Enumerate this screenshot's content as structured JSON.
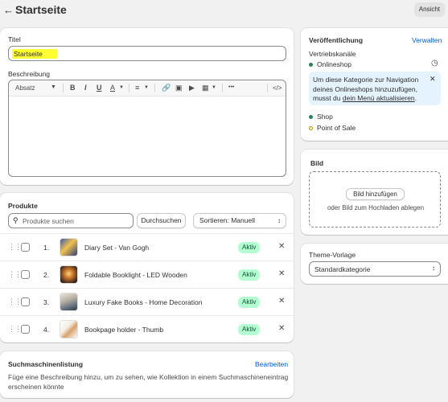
{
  "header": {
    "title": "Startseite",
    "view_label": "Ansicht"
  },
  "title_card": {
    "title_label": "Titel",
    "title_value": "Startseite",
    "description_label": "Beschreibung",
    "toolbar": {
      "format": "Absatz",
      "bold": "B",
      "italic": "I",
      "underline": "U",
      "text_color": "A",
      "more": "•••",
      "code": "</>"
    }
  },
  "products": {
    "heading": "Produkte",
    "search_placeholder": "Produkte suchen",
    "browse_label": "Durchsuchen",
    "sort_label": "Sortieren: Manuell",
    "items": [
      {
        "index": "1.",
        "name": "Diary Set - Van Gogh",
        "status": "Aktiv"
      },
      {
        "index": "2.",
        "name": "Foldable Booklight - LED Wooden",
        "status": "Aktiv"
      },
      {
        "index": "3.",
        "name": "Luxury Fake Books - Home Decoration",
        "status": "Aktiv"
      },
      {
        "index": "4.",
        "name": "Bookpage holder - Thumb",
        "status": "Aktiv"
      }
    ]
  },
  "seo": {
    "heading": "Suchmaschinenlistung",
    "edit_label": "Bearbeiten",
    "text": "Füge eine Beschreibung hinzu, um zu sehen, wie Kollektion in einem Suchmaschineneintrag erscheinen könnte"
  },
  "publishing": {
    "heading": "Veröffentlichung",
    "manage_label": "Verwalten",
    "channels_label": "Vertriebskanäle",
    "channel_online": "Onlineshop",
    "banner_text_1": "Um diese Kategorie zur Navigation deines Onlineshops hinzuzufügen, musst du",
    "banner_link": "dein Menü aktualisieren",
    "banner_text_2": ".",
    "channel_shop": "Shop",
    "channel_pos": "Point of Sale",
    "status_colors": {
      "active": "#29845a",
      "inactive": "#b98900"
    }
  },
  "image_card": {
    "heading": "Bild",
    "add_label": "Bild hinzufügen",
    "drop_hint": "oder Bild zum Hochladen ablegen"
  },
  "theme": {
    "heading": "Theme-Vorlage",
    "selected": "Standardkategorie"
  }
}
